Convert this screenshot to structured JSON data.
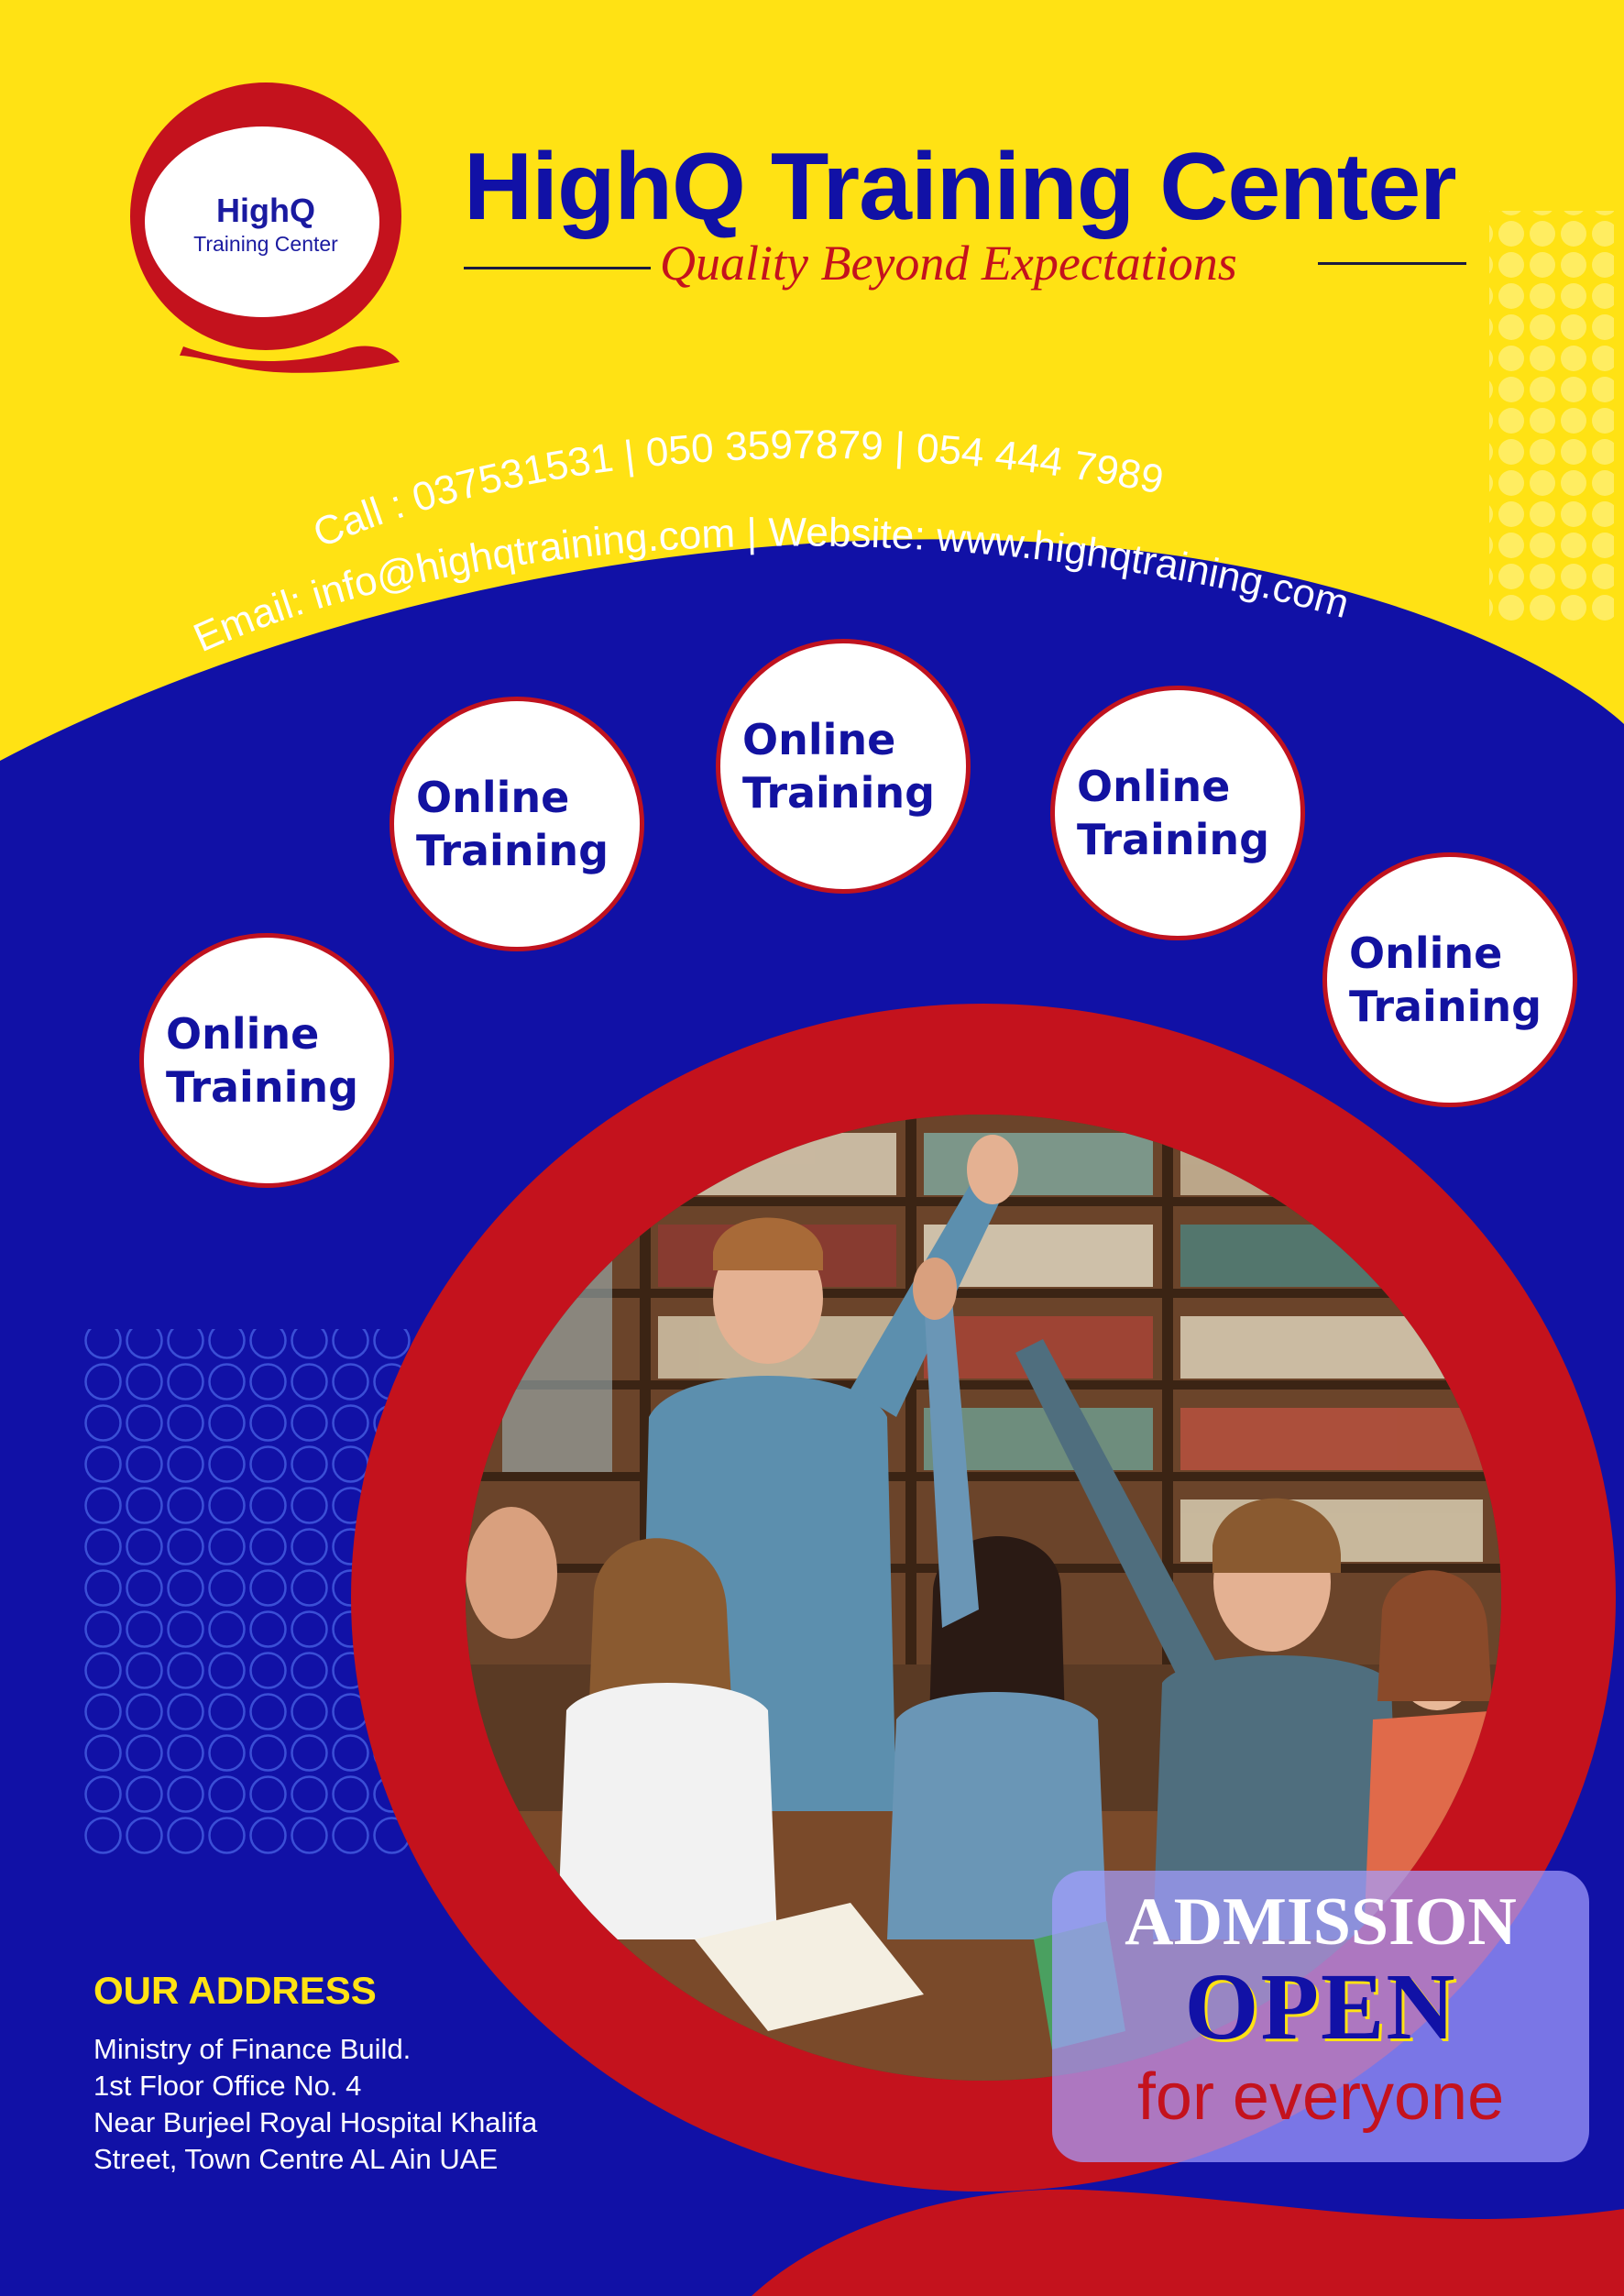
{
  "colors": {
    "yellow": "#ffe214",
    "blue": "#1111a6",
    "red": "#c4121d",
    "white": "#ffffff"
  },
  "logo": {
    "brand": "HighQ",
    "sub": "Training Center"
  },
  "header": {
    "title": "HighQ Training Center",
    "tagline": "Quality Beyond Expectations"
  },
  "contact": {
    "phones": "Call : 037531531  |  050 3597879  |  054 444 7989",
    "email_web": "Email: info@highqtraining.com | Website: www.highqtraining.com"
  },
  "bubbles": [
    "Online Training",
    "Online Training",
    "Online Training",
    "Online Training",
    "Online Training"
  ],
  "address": {
    "title": "OUR ADDRESS",
    "lines": [
      "Ministry of Finance Build.",
      "1st Floor Office No. 4",
      "Near Burjeel Royal Hospital Khalifa",
      "Street, Town Centre AL Ain UAE"
    ]
  },
  "admission": {
    "line1": "ADMISSION",
    "line2": "OPEN",
    "line3": "for everyone"
  }
}
